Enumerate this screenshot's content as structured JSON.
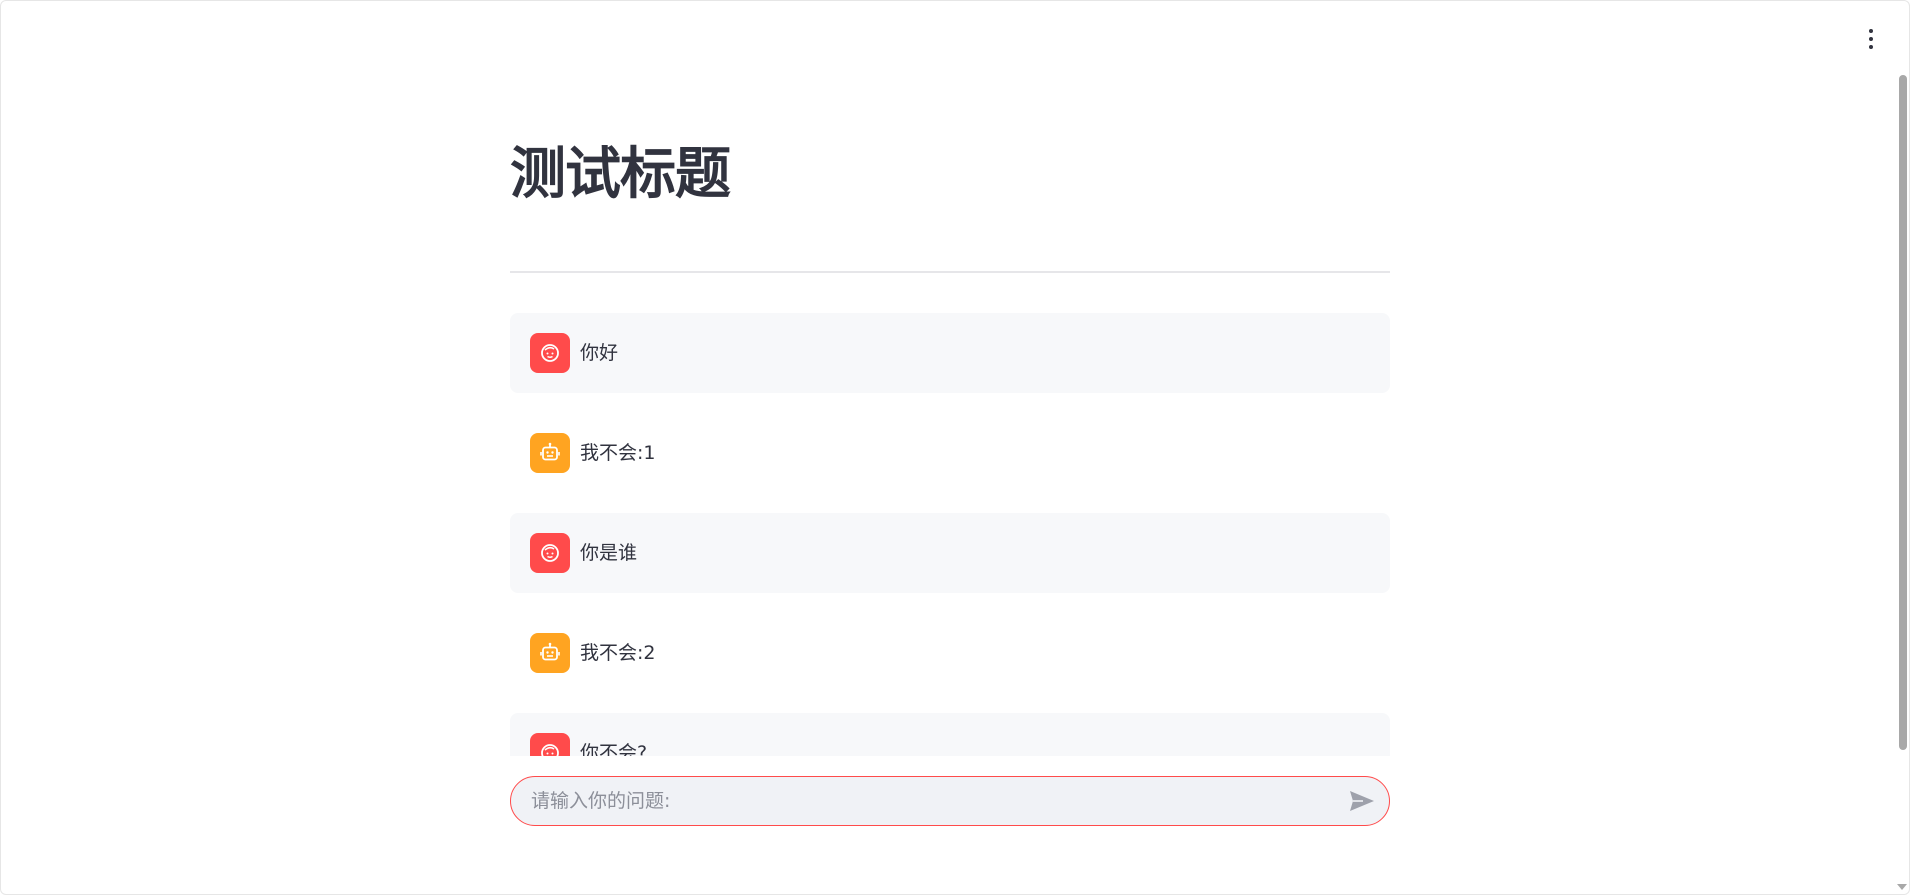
{
  "page": {
    "title": "测试标题"
  },
  "messages": [
    {
      "role": "user",
      "text": "你好",
      "avatar_icon": "user-face-icon"
    },
    {
      "role": "assistant",
      "text": "我不会:1",
      "avatar_icon": "robot-icon"
    },
    {
      "role": "user",
      "text": "你是谁",
      "avatar_icon": "user-face-icon"
    },
    {
      "role": "assistant",
      "text": "我不会:2",
      "avatar_icon": "robot-icon"
    },
    {
      "role": "user",
      "text": "你不会?",
      "avatar_icon": "user-face-icon"
    }
  ],
  "chat_input": {
    "placeholder": "请输入你的问题:",
    "value": "",
    "send_icon": "send-icon"
  },
  "header": {
    "menu_icon": "more-vertical-icon"
  },
  "colors": {
    "user_avatar": "#ff4b4b",
    "assistant_avatar": "#ffa421",
    "user_message_bg": "#f7f8fa",
    "input_border": "#ff4b4b",
    "input_bg": "#f0f2f6",
    "text": "#31333f"
  }
}
